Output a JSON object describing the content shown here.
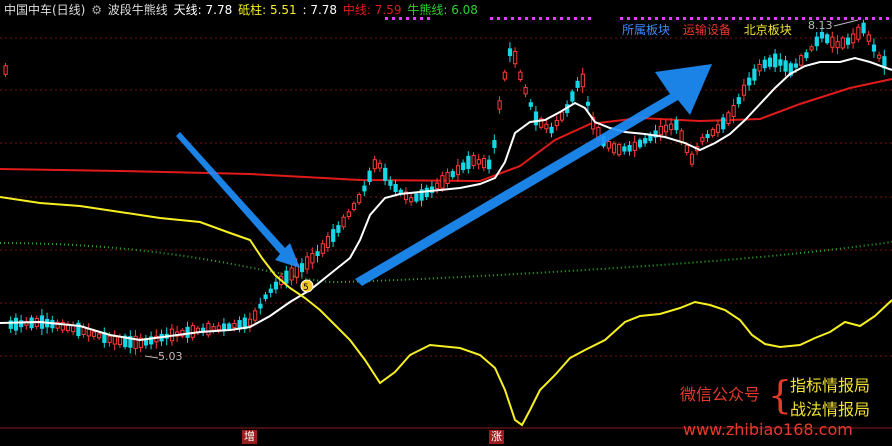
{
  "header": {
    "stock_label": "中国中车(日线)",
    "gear_icon": "gear-icon",
    "indicator_name": "波段牛熊线",
    "tianxian_label": "天线:",
    "tianxian_value": "7.78",
    "dizhu_label": "砥柱:",
    "dizhu_value": "5.51",
    "dizhu_extra": ": 7.78",
    "zhongxian_label": "中线:",
    "zhongxian_value": "7.59",
    "niuxiong_label": "牛熊线:",
    "niuxiong_value": "6.08"
  },
  "sector_tags": [
    "所属板块",
    "运输设备",
    "北京板块"
  ],
  "price_marks": {
    "high": "8.13",
    "low": "5.03"
  },
  "bottom_tags": {
    "zeng": "增",
    "zhang": "涨"
  },
  "watermark": {
    "line1": "微信公众号",
    "line2a": "指标情报局",
    "line2b": "战法情报局",
    "url": "www.zhibiao168.com"
  },
  "colors": {
    "background": "#000000",
    "up_candle": "#ff3b3b",
    "down_candle": "#17d7e6",
    "white_line": "#ffffff",
    "red_line": "#e11a1a",
    "yellow_line": "#f6f023",
    "green_dotted": "#2faa2f",
    "arrow_blue": "#1e90ff",
    "magenta_dots": "#e040fb"
  }
}
